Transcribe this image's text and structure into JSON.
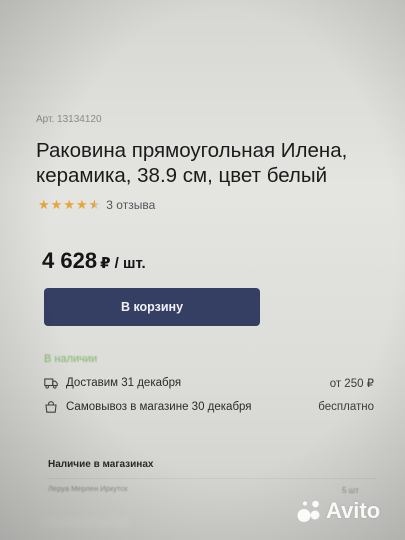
{
  "product": {
    "article": "Арт. 13134120",
    "title": "Раковина прямоугольная Илена, керамика, 38.9 см, цвет белый",
    "rating": 4.5,
    "reviews": "3 отзыва",
    "price": "4 628",
    "unit": "₽ / шт.",
    "add_to_cart": "В корзину"
  },
  "availability": {
    "status": "В наличии",
    "delivery_label": "Доставим 31 декабря",
    "delivery_price": "от 250 ₽",
    "pickup_label": "Самовывоз в магазине 30 декабря",
    "pickup_price": "бесплатно"
  },
  "stores": {
    "title": "Наличие в магазинах",
    "name": "Леруа Мерлен Иркутск",
    "qty": "5 шт"
  },
  "watermark": "Avito",
  "colors": {
    "accent": "#343f63",
    "stars": "#e7a53a",
    "in_stock": "#7fb96b"
  }
}
